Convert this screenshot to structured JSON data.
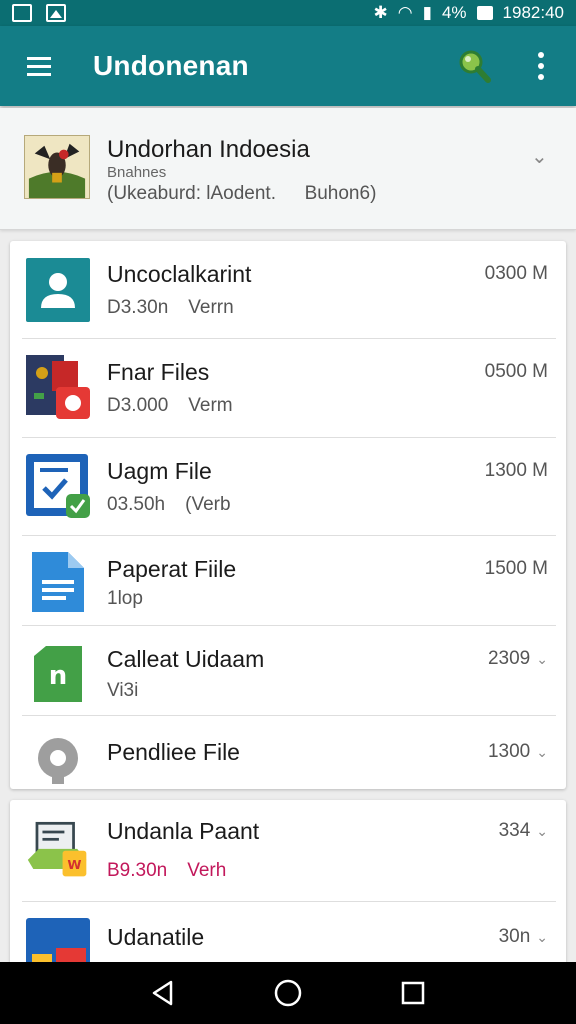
{
  "status_bar": {
    "battery_text": "4%",
    "time": "1982:40"
  },
  "app_bar": {
    "title": "Undonenan"
  },
  "header": {
    "title": "Undorhan Indoesia",
    "subtitle": "Bnahnes",
    "detail": "(Ukeaburd: lAodent.",
    "detail_right": "Buhon6)"
  },
  "files": [
    {
      "name": "Uncoclalkarint",
      "meta": "D3.30n",
      "tag": "Verrn",
      "size": "0300 M",
      "icon": "person-icon",
      "color": "#1b8b95"
    },
    {
      "name": "Fnar Files",
      "meta": "D3.000",
      "tag": "Verm",
      "size": "0500 M",
      "icon": "red-app-icon",
      "color": "#c62828"
    },
    {
      "name": "Uagm File",
      "meta": "03.50h",
      "tag": "(Verb",
      "size": "1300 M",
      "icon": "check-doc-icon",
      "color": "#1e63b8"
    },
    {
      "name": "Paperat Fiile",
      "meta": "1lop",
      "tag": "",
      "size": "1500 M",
      "icon": "doc-icon",
      "color": "#2f8bd9"
    },
    {
      "name": "Calleat Uidaam",
      "meta": "Vi3i",
      "tag": "",
      "size": "2309",
      "icon": "n-icon",
      "color": "#43a047"
    },
    {
      "name": "Pendliee File",
      "meta": "",
      "tag": "",
      "size": "1300",
      "icon": "record-icon",
      "color": "#888888"
    }
  ],
  "files2": [
    {
      "name": "Undanla Paant",
      "meta": "B9.30n",
      "tag": "Verh",
      "size": "334",
      "icon": "laptop-icon",
      "color": "#8bc34a",
      "meta_color": "#c2185b"
    },
    {
      "name": "Udanatile",
      "meta": "",
      "tag": "",
      "size": "30n",
      "icon": "blue-app-icon",
      "color": "#1e63b8"
    }
  ]
}
